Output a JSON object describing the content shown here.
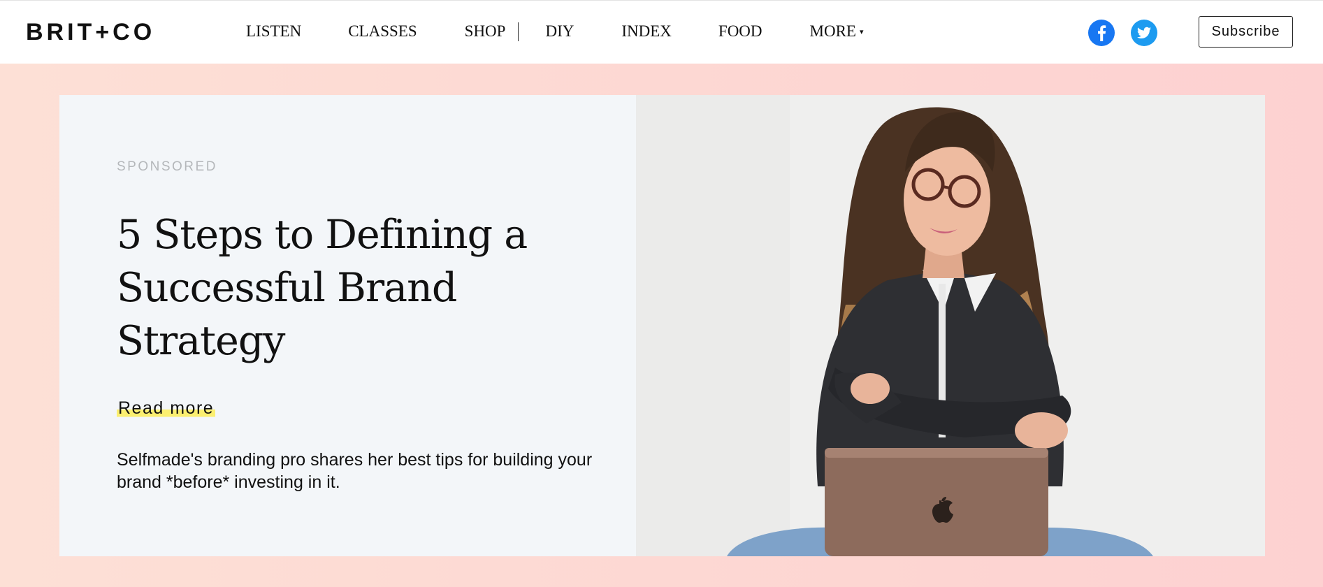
{
  "header": {
    "logo": "BRIT+CO",
    "nav": [
      {
        "label": "LISTEN"
      },
      {
        "label": "CLASSES"
      },
      {
        "label": "SHOP"
      },
      {
        "label": "DIY"
      },
      {
        "label": "INDEX"
      },
      {
        "label": "FOOD"
      },
      {
        "label": "MORE"
      }
    ],
    "subscribe_label": "Subscribe",
    "social": {
      "facebook_icon": "facebook-icon",
      "twitter_icon": "twitter-icon"
    }
  },
  "hero": {
    "sponsored_label": "SPONSORED",
    "headline": "5 Steps to Defining a Successful Brand Strategy",
    "read_more": "Read more",
    "dek": "Selfmade's branding pro shares her best tips for building your brand *before* investing in it."
  },
  "colors": {
    "background_pink": "#fdd8d3",
    "card_bg": "#f3f6f9",
    "highlight_yellow": "#fbef70",
    "facebook_blue": "#1877f2",
    "twitter_blue": "#1d9bf0"
  }
}
